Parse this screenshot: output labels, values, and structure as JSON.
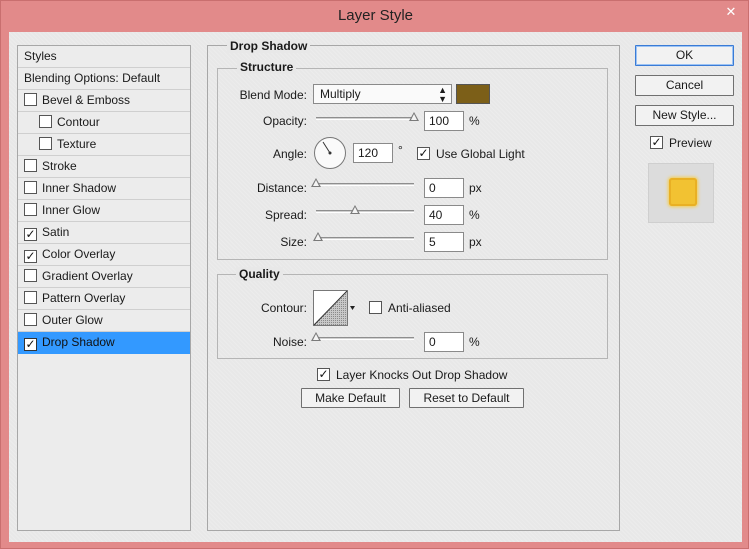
{
  "window": {
    "title": "Layer Style",
    "close_glyph": "✕"
  },
  "colors": {
    "shadow_color": "#7c5f18",
    "selected_row": "#3399ff",
    "preview_fill": "#f2c232"
  },
  "styles_panel": {
    "header": "Styles",
    "blending": "Blending Options: Default",
    "items": [
      {
        "label": "Bevel & Emboss",
        "checked": false,
        "sub": false
      },
      {
        "label": "Contour",
        "checked": false,
        "sub": true
      },
      {
        "label": "Texture",
        "checked": false,
        "sub": true
      },
      {
        "label": "Stroke",
        "checked": false,
        "sub": false
      },
      {
        "label": "Inner Shadow",
        "checked": false,
        "sub": false
      },
      {
        "label": "Inner Glow",
        "checked": false,
        "sub": false
      },
      {
        "label": "Satin",
        "checked": true,
        "sub": false
      },
      {
        "label": "Color Overlay",
        "checked": true,
        "sub": false
      },
      {
        "label": "Gradient Overlay",
        "checked": false,
        "sub": false
      },
      {
        "label": "Pattern Overlay",
        "checked": false,
        "sub": false
      },
      {
        "label": "Outer Glow",
        "checked": false,
        "sub": false
      },
      {
        "label": "Drop Shadow",
        "checked": true,
        "sub": false,
        "selected": true
      }
    ]
  },
  "drop_shadow": {
    "title": "Drop Shadow",
    "structure": {
      "title": "Structure",
      "blend_mode_label": "Blend Mode:",
      "blend_mode_value": "Multiply",
      "opacity_label": "Opacity:",
      "opacity_value": "100",
      "opacity_unit": "%",
      "opacity_level": 1.0,
      "angle_label": "Angle:",
      "angle_value": "120",
      "angle_unit": "°",
      "use_global_light_label": "Use Global Light",
      "use_global_light": true,
      "distance_label": "Distance:",
      "distance_value": "0",
      "distance_unit": "px",
      "distance_level": 0.0,
      "spread_label": "Spread:",
      "spread_value": "40",
      "spread_unit": "%",
      "spread_level": 0.4,
      "size_label": "Size:",
      "size_value": "5",
      "size_unit": "px",
      "size_level": 0.02
    },
    "quality": {
      "title": "Quality",
      "contour_label": "Contour:",
      "anti_aliased_label": "Anti-aliased",
      "anti_aliased": false,
      "noise_label": "Noise:",
      "noise_value": "0",
      "noise_unit": "%",
      "noise_level": 0.0
    },
    "knockout_label": "Layer Knocks Out Drop Shadow",
    "knockout": true,
    "make_default_label": "Make Default",
    "reset_default_label": "Reset to Default"
  },
  "right": {
    "ok_label": "OK",
    "cancel_label": "Cancel",
    "new_style_label": "New Style...",
    "preview_label": "Preview",
    "preview": true
  }
}
